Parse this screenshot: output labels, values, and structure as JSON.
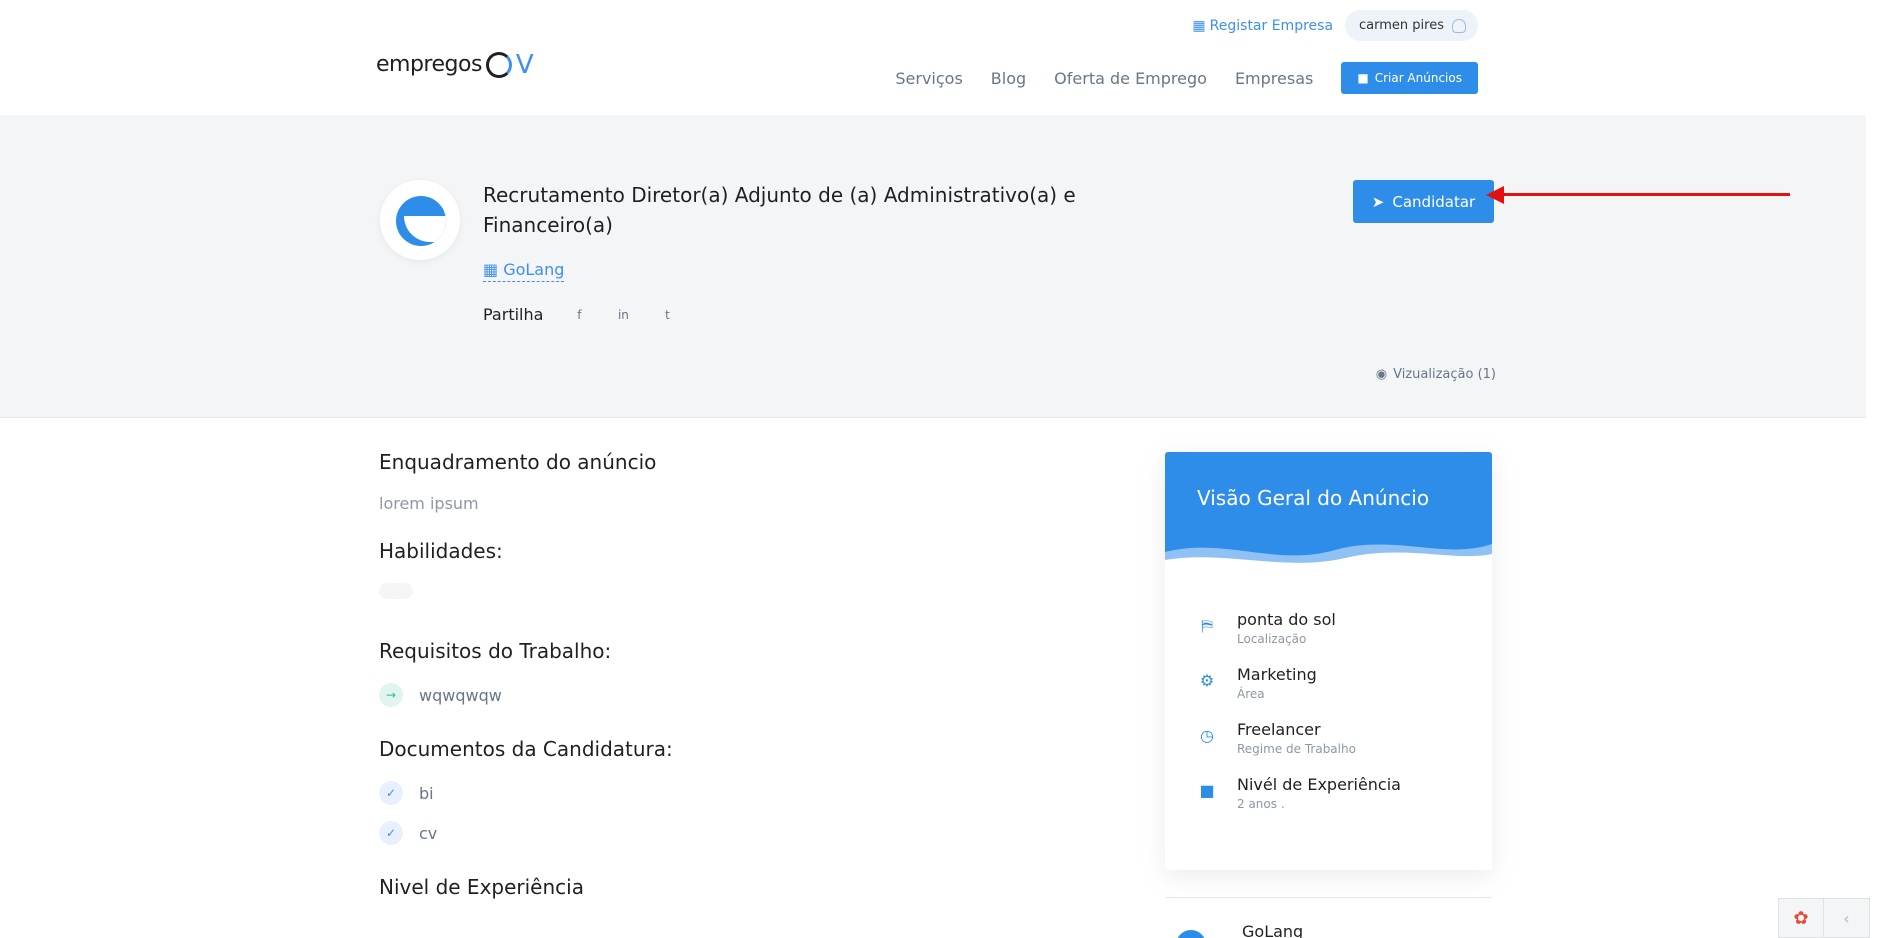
{
  "header": {
    "logo_text": "empregos",
    "logo_suffix": "V",
    "register_link": "Registar Empresa",
    "user_name": "carmen pires",
    "nav": [
      "Serviços",
      "Blog",
      "Oferta de Emprego",
      "Empresas"
    ],
    "create_ad_button": "Criar Anúncios"
  },
  "hero": {
    "title": "Recrutamento Diretor(a) Adjunto de (a) Administrativo(a) e Financeiro(a)",
    "company": "GoLang",
    "share_label": "Partilha",
    "apply_button": "Candidatar",
    "views": "Vizualização (1)"
  },
  "main": {
    "sections": {
      "enquadramento_title": "Enquadramento do anúncio",
      "enquadramento_text": "lorem ipsum",
      "habilidades_title": "Habilidades:",
      "requisitos_title": "Requisitos do Trabalho:",
      "documentos_title": "Documentos da Candidatura:",
      "nivel_title": "Nivel de Experiência"
    },
    "requisitos": [
      "wqwqwqw"
    ],
    "documentos": [
      "bi",
      "cv"
    ]
  },
  "overview": {
    "title": "Visão Geral do Anúncio",
    "items": [
      {
        "value": "ponta do sol",
        "label": "Localização",
        "icon": "map-icon"
      },
      {
        "value": "Marketing",
        "label": "Área",
        "icon": "gears-icon"
      },
      {
        "value": "Freelancer",
        "label": "Regime de Trabalho",
        "icon": "clock-icon"
      },
      {
        "value": "Nivél de Experiência",
        "label": "2 anos .",
        "icon": "briefcase-icon"
      }
    ]
  },
  "footer_company": "GoLang",
  "colors": {
    "accent": "#2d8de8",
    "arrow": "#e40f0f"
  }
}
